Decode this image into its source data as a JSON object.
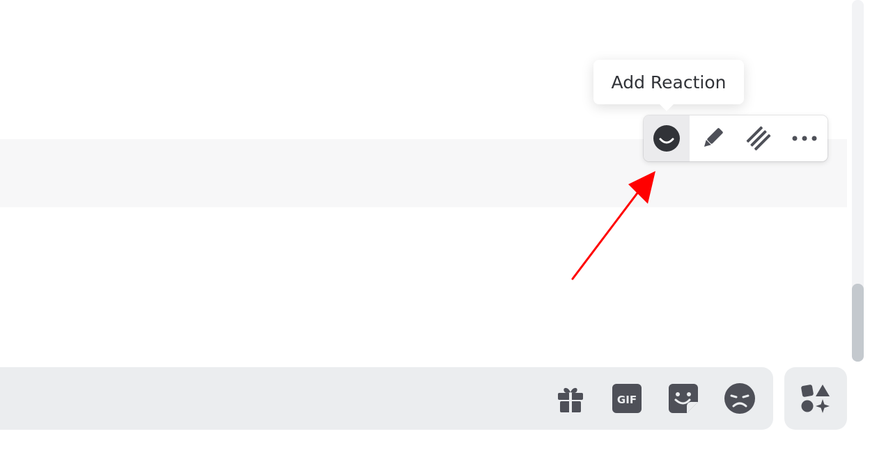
{
  "tooltip": {
    "text": "Add Reaction"
  },
  "message_toolbar": {
    "buttons": [
      {
        "name": "add-reaction",
        "icon": "smile-icon",
        "active": true
      },
      {
        "name": "edit",
        "icon": "pencil-icon"
      },
      {
        "name": "create-thread",
        "icon": "thread-icon"
      },
      {
        "name": "more",
        "icon": "ellipsis-icon"
      }
    ]
  },
  "composer": {
    "icons": [
      "gift-icon",
      "gif-icon",
      "sticker-icon",
      "emoji-icon"
    ],
    "gif_label": "GIF"
  },
  "apps_button": {
    "icon": "apps-icon"
  },
  "colors": {
    "icon": "#4e5058",
    "annotation_arrow": "#ff0000",
    "highlight_row": "#f7f7f8",
    "composer_bg": "#ebedef"
  }
}
